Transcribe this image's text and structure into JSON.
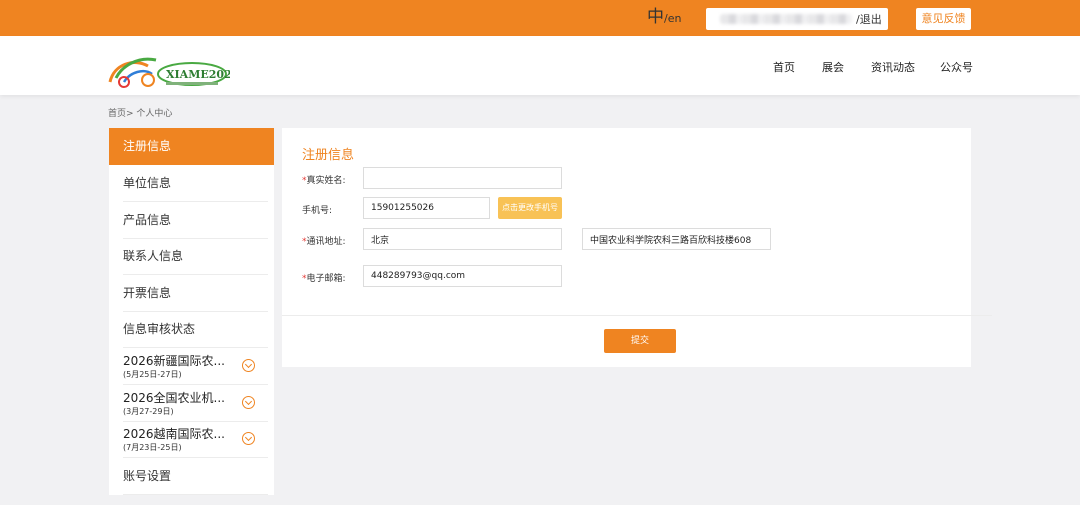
{
  "topbar": {
    "lang_zh": "中",
    "lang_en": "/en",
    "logout": "/退出",
    "feedback": "意见反馈"
  },
  "header": {
    "logo_text": "XIAME2026",
    "nav": [
      "首页",
      "展会",
      "资讯动态",
      "公众号"
    ]
  },
  "breadcrumb": "首页> 个人中心",
  "sidebar": {
    "items": [
      {
        "label": "注册信息"
      },
      {
        "label": "单位信息"
      },
      {
        "label": "产品信息"
      },
      {
        "label": "联系人信息"
      },
      {
        "label": "开票信息"
      },
      {
        "label": "信息审核状态"
      }
    ],
    "expos": [
      {
        "title": "2026新疆国际农...",
        "date": "(5月25日-27日)"
      },
      {
        "title": "2026全国农业机...",
        "date": "(3月27-29日)"
      },
      {
        "title": "2026越南国际农...",
        "date": "(7月23日-25日)"
      }
    ],
    "account": "账号设置"
  },
  "form": {
    "title": "注册信息",
    "name_label": "真实姓名:",
    "name_value": "",
    "phone_label": "手机号:",
    "phone_value": "15901255026",
    "change_phone": "点击更改手机号",
    "address_label": "通讯地址:",
    "address_city": "北京",
    "address_detail": "中国农业科学院农科三路百欣科技楼608",
    "email_label": "电子邮箱:",
    "email_value": "448289793@qq.com",
    "required_mark": "*",
    "submit": "提交"
  },
  "colors": {
    "accent": "#ef8421",
    "button_secondary": "#f8c256",
    "page_bg": "#f1f1f3"
  }
}
